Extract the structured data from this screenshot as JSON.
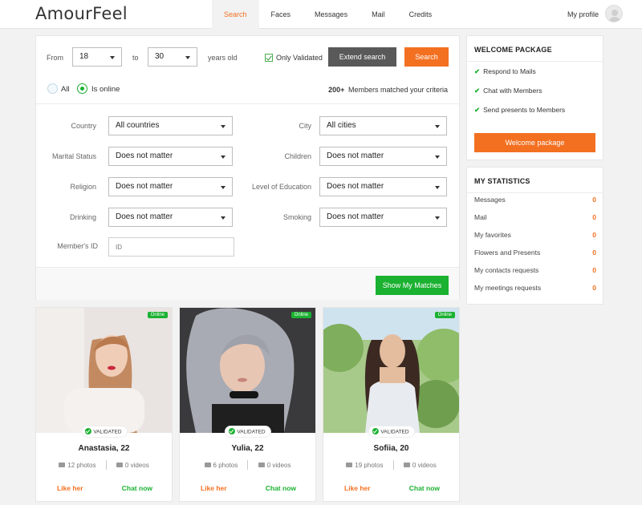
{
  "app": {
    "logo": "AmourFeel"
  },
  "nav": {
    "items": [
      {
        "label": "Search",
        "active": true
      },
      {
        "label": "Faces"
      },
      {
        "label": "Messages"
      },
      {
        "label": "Mail"
      },
      {
        "label": "Credits"
      }
    ],
    "profile_label": "My profile"
  },
  "search": {
    "from_label": "From",
    "age_from": "18",
    "to_label": "to",
    "age_to": "30",
    "years_label": "years old",
    "only_validated_label": "Only Validated",
    "only_validated_checked": true,
    "extend_label": "Extend search",
    "search_label": "Search",
    "radio_all_label": "All",
    "radio_online_label": "Is online",
    "selected_radio": "Is online",
    "matched_count": "200+",
    "matched_text": "Members matched your criteria",
    "filters": {
      "country": {
        "label": "Country",
        "value": "All countries"
      },
      "city": {
        "label": "City",
        "value": "All cities"
      },
      "marital": {
        "label": "Marital Status",
        "value": "Does not matter"
      },
      "children": {
        "label": "Children",
        "value": "Does not matter"
      },
      "religion": {
        "label": "Religion",
        "value": "Does not matter"
      },
      "education": {
        "label": "Level of Education",
        "value": "Does not matter"
      },
      "drinking": {
        "label": "Drinking",
        "value": "Does not matter"
      },
      "smoking": {
        "label": "Smoking",
        "value": "Does not matter"
      }
    },
    "member_id_label": "Member's ID",
    "member_id_placeholder": "ID",
    "show_matches_label": "Show My Matches"
  },
  "welcome": {
    "title": "WELCOME PACKAGE",
    "items": [
      "Respond to Mails",
      "Chat with Members",
      "Send presents to Members"
    ],
    "button_label": "Welcome package"
  },
  "stats": {
    "title": "MY STATISTICS",
    "rows": [
      {
        "label": "Messages",
        "value": "0"
      },
      {
        "label": "Mail",
        "value": "0"
      },
      {
        "label": "My favorites",
        "value": "0"
      },
      {
        "label": "Flowers and Presents",
        "value": "0"
      },
      {
        "label": "My contacts requests",
        "value": "0"
      },
      {
        "label": "My meetings requests",
        "value": "0"
      }
    ]
  },
  "cards": [
    {
      "name": "Anastasia, 22",
      "photos": "12 photos",
      "videos": "0 videos",
      "online": "Online",
      "validated": "VALIDATED",
      "like": "Like her",
      "chat": "Chat now"
    },
    {
      "name": "Yulia, 22",
      "photos": "6 photos",
      "videos": "0 videos",
      "online": "Online",
      "validated": "VALIDATED",
      "like": "Like her",
      "chat": "Chat now"
    },
    {
      "name": "Sofiia, 20",
      "photos": "19 photos",
      "videos": "0 videos",
      "online": "Online",
      "validated": "VALIDATED",
      "like": "Like her",
      "chat": "Chat now"
    }
  ],
  "colors": {
    "accent": "#f37021",
    "green": "#1bb131",
    "gray_button": "#595959"
  }
}
